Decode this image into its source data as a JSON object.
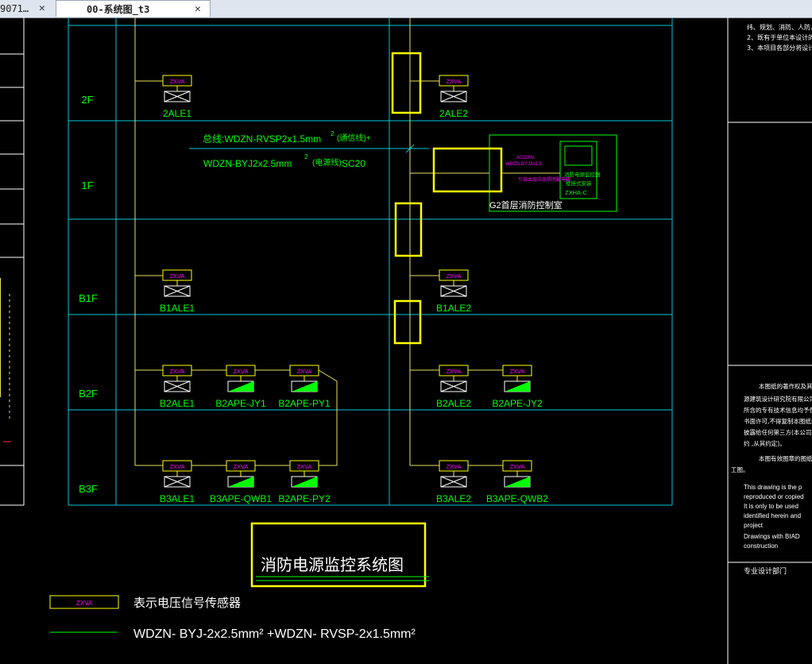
{
  "tabs": [
    {
      "label": "9071…",
      "active": false
    },
    {
      "label": "00-系统图_t3",
      "active": true
    }
  ],
  "floors": [
    "2F",
    "1F",
    "B1F",
    "B2F",
    "B3F"
  ],
  "sensor_label": "ZXVA",
  "devices": {
    "f2_left": "2ALE1",
    "f2_right": "2ALE2",
    "b1_left": "B1ALE1",
    "b1_right": "B1ALE2",
    "b2_1": "B2ALE1",
    "b2_2": "B2APE-JY1",
    "b2_3": "B2APE-PY1",
    "b2_4": "B2ALE2",
    "b2_5": "B2APE-JY2",
    "b3_1": "B3ALE1",
    "b3_2": "B3APE-QWB1",
    "b3_3": "B2APE-PY2",
    "b3_4": "B3ALE2",
    "b3_5": "B3APE-QWB2"
  },
  "cable_note": {
    "line1": "总线:WDZN-RVSP2x1.5mm",
    "line1_sup": "2",
    "line1_tail": "(通信线)+",
    "line2": "WDZN-BYJ2x2.5mm",
    "line2_sup": "2",
    "line2_tail": "(电源线)",
    "line2_pipe": "SC20"
  },
  "control_room": {
    "label": "G2首层消防控制室",
    "small1": "AC220V",
    "small2": "WDZN-BYJ3x2.5",
    "small3": "引自本层应急照明配电箱",
    "panel_text1": "消防电源监控器",
    "panel_text2": "壁挂式安装",
    "panel_model": "ZXHA-C"
  },
  "diagram_title": "消防电源监控系统图",
  "legend": {
    "sensor_desc": "表示电压信号传感器",
    "cable_desc": "WDZN- BYJ-2x2.5mm² +WDZN- RVSP-2x1.5mm²"
  },
  "notes_top": [
    "纬、规划、消防、人防、节",
    "2、既有于单位本设计的资",
    "3、本项目各部分将设计分"
  ],
  "copyright_cn": [
    "本图纸的著作权及其他",
    "源建筑设计研究院有限公司(B",
    "所含的专有技术信息均予保密",
    "书面许可,不得复制本图纸或",
    "披露给任何第三方(本公司与",
    "约 ,从其约定)。",
    "本图有效图章的图纸为",
    "工图。"
  ],
  "copyright_en": [
    "This drawing is the p",
    "reproduced or copied",
    "It is only to be used",
    "identified herein and",
    "project",
    "Drawings with BIAD",
    "construction"
  ],
  "dept_label": "专业设计部门",
  "colors": {
    "frame": "#00c8d8",
    "bus": "#e8e060",
    "device_box": "#ffff00",
    "device_text": "#ff00ff",
    "label_green": "#00ff00",
    "highlight": "#ffff00",
    "white": "#ffffff"
  }
}
